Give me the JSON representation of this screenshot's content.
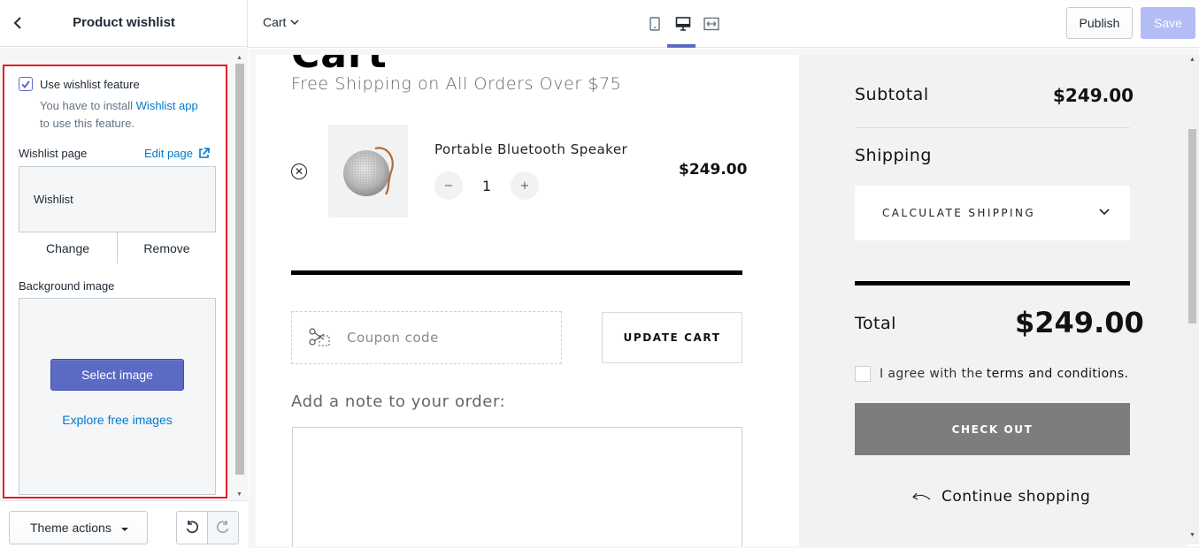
{
  "sidebar": {
    "title": "Product wishlist",
    "panel": {
      "checkbox_label": "Use wishlist feature",
      "checkbox_checked": true,
      "help_prefix": "You have to install ",
      "help_link": "Wishlist app",
      "help_suffix": "to use this feature.",
      "wishlist_page_label": "Wishlist page",
      "edit_page_label": "Edit page",
      "wishlist_page_value": "Wishlist",
      "change_label": "Change",
      "remove_label": "Remove",
      "background_label": "Background image",
      "select_image_label": "Select image",
      "explore_label": "Explore free images"
    },
    "footer": {
      "theme_actions_label": "Theme actions"
    }
  },
  "topbar": {
    "template_select": "Cart",
    "publish_label": "Publish",
    "save_label": "Save",
    "active_view": "desktop"
  },
  "preview": {
    "heading_partial": "Cart",
    "free_shipping": "Free Shipping on All Orders Over $75",
    "item": {
      "name": "Portable Bluetooth Speaker",
      "quantity": "1",
      "price": "$249.00",
      "minus": "−",
      "plus": "+"
    },
    "coupon_placeholder": "Coupon code",
    "update_cart_label": "UPDATE CART",
    "note_label": "Add a note to your order:",
    "summary": {
      "subtotal_label": "Subtotal",
      "subtotal_value": "$249.00",
      "shipping_label": "Shipping",
      "calculate_shipping": "CALCULATE SHIPPING",
      "total_label": "Total",
      "total_value": "$249.00",
      "agree_prefix": "I agree with the",
      "agree_terms": "terms and conditions.",
      "checkout_label": "CHECK OUT",
      "continue_label": "Continue shopping"
    }
  },
  "colors": {
    "accent": "#5c6ac4",
    "link": "#007ace",
    "highlight_border": "#e31e24",
    "checkout_bg": "#7d7d7d",
    "save_disabled": "#b3bcf5"
  }
}
